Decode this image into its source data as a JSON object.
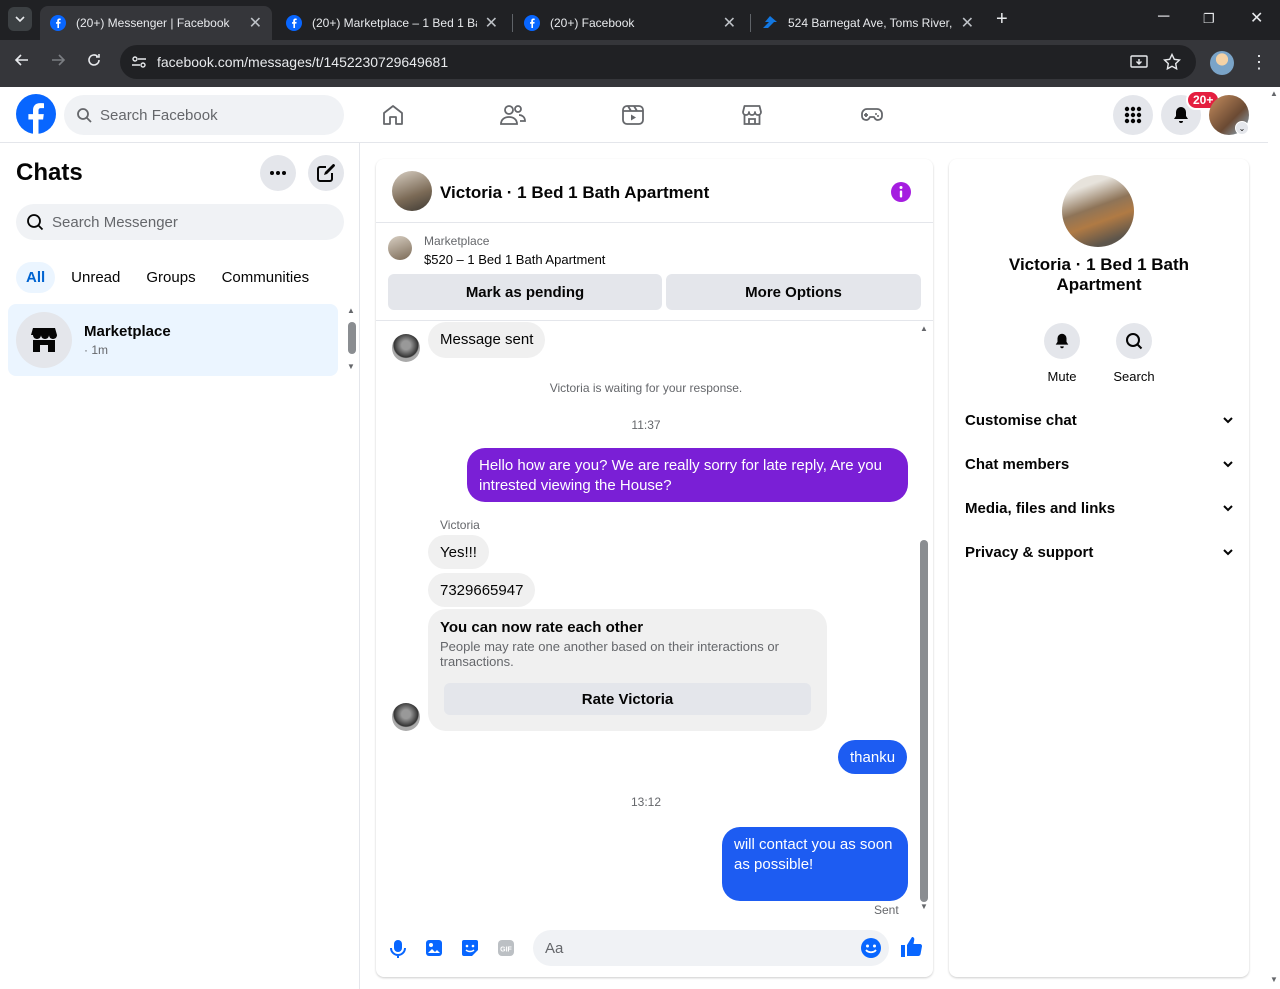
{
  "browser": {
    "tabs": [
      {
        "title": "(20+) Messenger | Facebook",
        "active": true
      },
      {
        "title": "(20+) Marketplace – 1 Bed 1 Bath",
        "active": false
      },
      {
        "title": "(20+) Facebook",
        "active": false
      },
      {
        "title": "524 Barnegat Ave, Toms River, N",
        "active": false
      }
    ],
    "url": "facebook.com/messages/t/1452230729649681"
  },
  "fb": {
    "search_placeholder": "Search Facebook",
    "notifications_badge": "20+"
  },
  "sidebar": {
    "title": "Chats",
    "search_placeholder": "Search Messenger",
    "filters": [
      "All",
      "Unread",
      "Groups",
      "Communities"
    ],
    "chats": [
      {
        "name": "Marketplace",
        "time": "· 1m"
      }
    ]
  },
  "conversation": {
    "title": "Victoria · 1 Bed 1 Bath Apartment",
    "listing_label": "Marketplace",
    "listing_title": "$520 – 1 Bed 1 Bath Apartment",
    "mark_pending": "Mark as pending",
    "more_options": "More Options",
    "messages": {
      "m1": "Message sent",
      "sys1": "Victoria is waiting for your response.",
      "time1": "11:37",
      "m2": "Hello how are you? We are really sorry for late reply, Are you intrested viewing the House?",
      "sender": "Victoria",
      "m3": "Yes!!!",
      "m4": "7329665947",
      "rate_title": "You can now rate each other",
      "rate_desc": "People may rate one another based on their interactions or transactions.",
      "rate_btn": "Rate Victoria",
      "m5": "thanku",
      "time2": "13:12",
      "m6": "will contact you as soon as possible!",
      "status": "Sent"
    },
    "composer_placeholder": "Aa"
  },
  "panel": {
    "name": "Victoria · 1 Bed 1 Bath Apartment",
    "mute": "Mute",
    "search": "Search",
    "sections": [
      "Customise chat",
      "Chat members",
      "Media, files and links",
      "Privacy & support"
    ]
  },
  "colors": {
    "fb_blue": "#0866ff",
    "my_bubble_purple": "#7a1fd6",
    "my_bubble_blue": "#1d5cf2",
    "badge_red": "#e41e3f"
  }
}
